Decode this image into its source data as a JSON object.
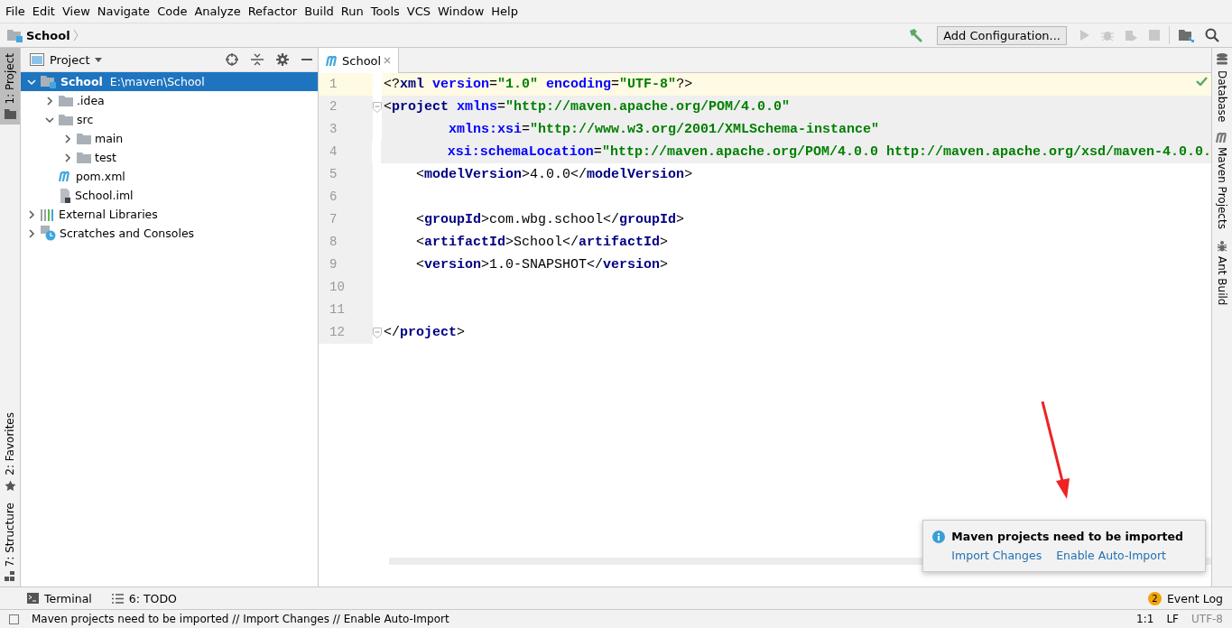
{
  "menu": [
    "File",
    "Edit",
    "View",
    "Navigate",
    "Code",
    "Analyze",
    "Refactor",
    "Build",
    "Run",
    "Tools",
    "VCS",
    "Window",
    "Help"
  ],
  "breadcrumb": {
    "label": "School"
  },
  "toolbar": {
    "run_config": "Add Configuration..."
  },
  "left_stripe": {
    "top": [
      {
        "label": "1: Project",
        "selected": true,
        "kind": "folder"
      }
    ],
    "bottom": [
      {
        "label": "2: Favorites",
        "selected": false,
        "kind": "star"
      },
      {
        "label": "7: Structure",
        "selected": false,
        "kind": "structure"
      }
    ]
  },
  "project_panel": {
    "title": "Project",
    "tree": [
      {
        "label": "School",
        "path": "E:\\maven\\School",
        "kind": "module",
        "expanded": true,
        "selected": true,
        "children": [
          {
            "label": ".idea",
            "kind": "folder",
            "expanded": false,
            "selected": false
          },
          {
            "label": "src",
            "kind": "folder",
            "expanded": true,
            "selected": false,
            "children": [
              {
                "label": "main",
                "kind": "folder",
                "expanded": false,
                "selected": false
              },
              {
                "label": "test",
                "kind": "folder",
                "expanded": false,
                "selected": false
              }
            ]
          },
          {
            "label": "pom.xml",
            "kind": "maven",
            "selected": false
          },
          {
            "label": "School.iml",
            "kind": "iml",
            "selected": false
          }
        ]
      },
      {
        "label": "External Libraries",
        "kind": "libraries",
        "expanded": false,
        "selected": false
      },
      {
        "label": "Scratches and Consoles",
        "kind": "scratches",
        "expanded": false,
        "selected": false
      }
    ]
  },
  "editor": {
    "tabs": [
      {
        "label": "School",
        "selected": true
      }
    ],
    "lines": [
      {
        "number": "1",
        "current": true,
        "shaded": false,
        "fold": false,
        "segments": [
          {
            "kind": "punct",
            "text": "<?"
          },
          {
            "kind": "tag",
            "text": "xml"
          },
          {
            "kind": "attr",
            "text": " version"
          },
          {
            "kind": "punct",
            "text": "="
          },
          {
            "kind": "str",
            "text": "\"1.0\""
          },
          {
            "kind": "attr",
            "text": " encoding"
          },
          {
            "kind": "punct",
            "text": "="
          },
          {
            "kind": "str",
            "text": "\"UTF-8\""
          },
          {
            "kind": "punct",
            "text": "?>"
          }
        ]
      },
      {
        "number": "2",
        "current": false,
        "shaded": true,
        "fold": true,
        "segments": [
          {
            "kind": "punct",
            "text": "<"
          },
          {
            "kind": "tag",
            "text": "project"
          },
          {
            "kind": "attr",
            "text": " xmlns"
          },
          {
            "kind": "punct",
            "text": "="
          },
          {
            "kind": "str",
            "text": "\"http://maven.apache.org/POM/4.0.0\""
          }
        ]
      },
      {
        "number": "3",
        "current": false,
        "shaded": true,
        "fold": false,
        "segments": [
          {
            "kind": "attr",
            "text": "        xmlns:xsi"
          },
          {
            "kind": "punct",
            "text": "="
          },
          {
            "kind": "str",
            "text": "\"http://www.w3.org/2001/XMLSchema-instance\""
          }
        ]
      },
      {
        "number": "4",
        "current": false,
        "shaded": true,
        "fold": false,
        "segments": [
          {
            "kind": "attr",
            "text": "        xsi:schemaLocation"
          },
          {
            "kind": "punct",
            "text": "="
          },
          {
            "kind": "str",
            "text": "\"http://maven.apache.org/POM/4.0.0 http://maven.apache.org/xsd/maven-4.0.0."
          }
        ]
      },
      {
        "number": "5",
        "current": false,
        "shaded": false,
        "fold": false,
        "segments": [
          {
            "kind": "punct",
            "text": "    <"
          },
          {
            "kind": "tag",
            "text": "modelVersion"
          },
          {
            "kind": "punct",
            "text": ">"
          },
          {
            "kind": "text",
            "text": "4.0.0"
          },
          {
            "kind": "punct",
            "text": "</"
          },
          {
            "kind": "tag",
            "text": "modelVersion"
          },
          {
            "kind": "punct",
            "text": ">"
          }
        ]
      },
      {
        "number": "6",
        "current": false,
        "shaded": false,
        "fold": false
      },
      {
        "number": "7",
        "current": false,
        "shaded": false,
        "fold": false,
        "segments": [
          {
            "kind": "punct",
            "text": "    <"
          },
          {
            "kind": "tag",
            "text": "groupId"
          },
          {
            "kind": "punct",
            "text": ">"
          },
          {
            "kind": "text",
            "text": "com.wbg.school"
          },
          {
            "kind": "punct",
            "text": "</"
          },
          {
            "kind": "tag",
            "text": "groupId"
          },
          {
            "kind": "punct",
            "text": ">"
          }
        ]
      },
      {
        "number": "8",
        "current": false,
        "shaded": false,
        "fold": false,
        "segments": [
          {
            "kind": "punct",
            "text": "    <"
          },
          {
            "kind": "tag",
            "text": "artifactId"
          },
          {
            "kind": "punct",
            "text": ">"
          },
          {
            "kind": "text",
            "text": "School"
          },
          {
            "kind": "punct",
            "text": "</"
          },
          {
            "kind": "tag",
            "text": "artifactId"
          },
          {
            "kind": "punct",
            "text": ">"
          }
        ]
      },
      {
        "number": "9",
        "current": false,
        "shaded": false,
        "fold": false,
        "segments": [
          {
            "kind": "punct",
            "text": "    <"
          },
          {
            "kind": "tag",
            "text": "version"
          },
          {
            "kind": "punct",
            "text": ">"
          },
          {
            "kind": "text",
            "text": "1.0-SNAPSHOT"
          },
          {
            "kind": "punct",
            "text": "</"
          },
          {
            "kind": "tag",
            "text": "version"
          },
          {
            "kind": "punct",
            "text": ">"
          }
        ]
      },
      {
        "number": "10",
        "current": false,
        "shaded": false,
        "fold": false
      },
      {
        "number": "11",
        "current": false,
        "shaded": false,
        "fold": false
      },
      {
        "number": "12",
        "current": false,
        "shaded": false,
        "fold": true,
        "segments": [
          {
            "kind": "punct",
            "text": "</"
          },
          {
            "kind": "tag",
            "text": "project"
          },
          {
            "kind": "punct",
            "text": ">"
          }
        ]
      }
    ]
  },
  "notification": {
    "title": "Maven projects need to be imported",
    "links": [
      "Import Changes",
      "Enable Auto-Import"
    ]
  },
  "right_stripe": [
    {
      "label": "Database",
      "kind": "database"
    },
    {
      "label": "Maven Projects",
      "kind": "maven"
    },
    {
      "label": "Ant Build",
      "kind": "ant"
    }
  ],
  "bottom_bar": {
    "tools": [
      {
        "label": "Terminal",
        "kind": "terminal"
      },
      {
        "label": "6: TODO",
        "kind": "todo"
      }
    ],
    "event_log": {
      "count": "2",
      "label": "Event Log"
    }
  },
  "status_bar": {
    "message": "Maven projects need to be imported // Import Changes // Enable Auto-Import",
    "position": "1:1",
    "line_separator": "LF",
    "encoding": "UTF-8"
  }
}
